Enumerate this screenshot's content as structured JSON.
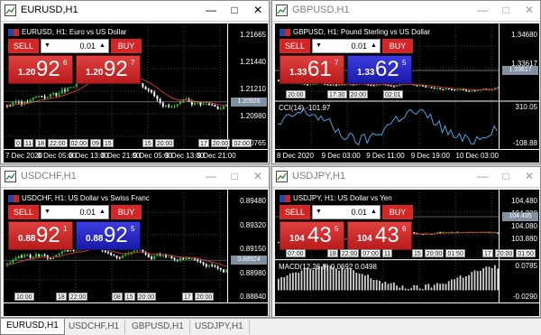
{
  "windows": [
    {
      "id": "w1",
      "title": "EURUSD,H1",
      "active": true,
      "label": "EURUSD, H1:  Euro vs US Dollar",
      "sell": "SELL",
      "buy": "BUY",
      "lot": "0.01",
      "bid": {
        "small": "1.20",
        "big": "92",
        "sup": "6"
      },
      "ask": {
        "small": "1.20",
        "big": "92",
        "sup": "7"
      },
      "ask_blue": false,
      "bid_blue": false,
      "yticks": [
        "1.21665",
        "1.21440",
        "1.21210",
        "1.20980",
        "1.20765"
      ],
      "price_tag": "1.20926",
      "xticks": [
        "7 Dec 2020",
        "8 Dec 05:00",
        "8 Dec 13:00",
        "8 Dec 21:00",
        "9 Dec 05:00",
        "9 Dec 13:00",
        "9 Dec 21:00"
      ],
      "timeline": [
        [
          "0",
          "11",
          "18",
          "22:00",
          "02:00",
          "09",
          "15"
        ],
        [
          "15",
          "20:00"
        ],
        [
          "17",
          "20:00",
          "02:00"
        ]
      ],
      "indicator": null
    },
    {
      "id": "w2",
      "title": "GBPUSD,H1",
      "active": false,
      "label": "GBPUSD, H1:  Pound Sterling vs US Dollar",
      "sell": "SELL",
      "buy": "BUY",
      "lot": "0.01",
      "bid": {
        "small": "1.33",
        "big": "61",
        "sup": "7"
      },
      "ask": {
        "small": "1.33",
        "big": "62",
        "sup": "5"
      },
      "ask_blue": true,
      "bid_blue": false,
      "yticks": [
        "1.34680",
        "1.33617",
        "310.05",
        "-108.88"
      ],
      "price_tag": "1.33617",
      "xticks": [
        "8 Dec 2020",
        "9 Dec 03:00",
        "9 Dec 11:00",
        "9 Dec 19:00",
        "10 Dec 03:00"
      ],
      "timeline": [
        [
          "20:00"
        ],
        [
          "17:30",
          "20:00"
        ],
        [
          "02:01"
        ]
      ],
      "indicator": {
        "name": "CCI(14) -101.97",
        "tick_top": "310.05",
        "tick_bottom": "-108.88"
      }
    },
    {
      "id": "w3",
      "title": "USDCHF,H1",
      "active": false,
      "label": "USDCHF, H1:  US Dollar vs Swiss Franc",
      "sell": "SELL",
      "buy": "BUY",
      "lot": "0.01",
      "bid": {
        "small": "0.88",
        "big": "92",
        "sup": "1"
      },
      "ask": {
        "small": "0.88",
        "big": "92",
        "sup": "5"
      },
      "ask_blue": true,
      "bid_blue": false,
      "yticks": [
        "0.89480",
        "0.89320",
        "0.89150",
        "0.88980",
        "0.88840"
      ],
      "price_tag": "0.88924",
      "xticks": [],
      "timeline": [
        [
          "10:00"
        ],
        [
          "18",
          "22:00"
        ],
        [
          "08",
          "15",
          "20:00"
        ],
        [
          "17",
          "20:00"
        ]
      ],
      "indicator": null
    },
    {
      "id": "w4",
      "title": "USDJPY,H1",
      "active": false,
      "label": "USDJPY, H1:  US Dollar vs Yen",
      "sell": "SELL",
      "buy": "BUY",
      "lot": "0.01",
      "bid": {
        "small": "104",
        "big": "43",
        "sup": "5"
      },
      "ask": {
        "small": "104",
        "big": "43",
        "sup": "6"
      },
      "ask_blue": false,
      "bid_blue": false,
      "yticks": [
        "104.480",
        "104.280",
        "104.080",
        "103.880",
        "0.0785",
        "-0.0290"
      ],
      "price_tag": "104.435",
      "xticks": [],
      "timeline": [
        [
          "07:00"
        ],
        [
          "18",
          "22:00",
          "07:00",
          "11"
        ],
        [
          "15",
          "20:00",
          "01:50"
        ],
        [
          "17",
          "20:00",
          "01:50"
        ]
      ],
      "indicator": {
        "name": "MACD(12,26,9) 0.0692 0.0498",
        "tick_top": "0.0785",
        "tick_bottom": "-0.0290"
      }
    }
  ],
  "tabs": [
    "EURUSD,H1",
    "USDCHF,H1",
    "GBPUSD,H1",
    "USDJPY,H1"
  ],
  "icons": {
    "minimize": "minimize-icon",
    "maximize": "maximize-icon",
    "close": "close-icon"
  },
  "colors": {
    "bull_candle": "#1ec81e",
    "bear_candle": "#ffffff",
    "grid": "#3a3a3a",
    "ma_line": "#c0392b",
    "sell_bg": "#d32626",
    "buy_bg_blue": "#2a2ad0"
  }
}
